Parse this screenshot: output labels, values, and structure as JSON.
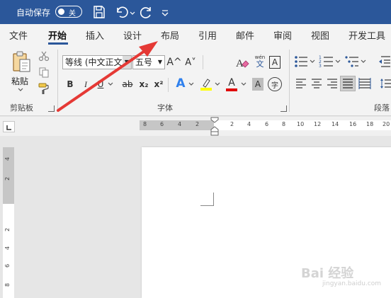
{
  "titlebar": {
    "autosave_label": "自动保存",
    "autosave_state": "关",
    "bg_color": "#2b579a"
  },
  "qat": {
    "save": "save-icon",
    "undo": "undo-icon",
    "redo": "redo-icon",
    "customize": "customize-icon"
  },
  "tabs": [
    {
      "label": "文件"
    },
    {
      "label": "开始",
      "active": true
    },
    {
      "label": "插入"
    },
    {
      "label": "设计"
    },
    {
      "label": "布局"
    },
    {
      "label": "引用"
    },
    {
      "label": "邮件"
    },
    {
      "label": "审阅"
    },
    {
      "label": "视图"
    },
    {
      "label": "开发工具"
    }
  ],
  "clipboard": {
    "paste_label": "粘贴",
    "group_label": "剪贴板"
  },
  "font": {
    "name": "等线 (中文正文",
    "size": "五号",
    "group_label": "字体",
    "bold": "B",
    "italic": "I",
    "underline": "U",
    "strikethrough": "ab",
    "subscript": "x₂",
    "superscript": "x²",
    "grow": "A^",
    "shrink": "A˅",
    "clear": "A",
    "phonetic": "wén",
    "phonetic_char": "文",
    "border_char": "A",
    "effect": "A",
    "highlight_color": "#ffff00",
    "font_color_char": "A",
    "font_color": "#e00000",
    "shading_char": "A",
    "enclose_char": "字"
  },
  "paragraph": {
    "group_label": "段落"
  },
  "ruler": {
    "h_left": [
      "8",
      "6",
      "4",
      "2"
    ],
    "h_right": [
      "2",
      "4",
      "6",
      "8",
      "10",
      "12",
      "14",
      "16",
      "18",
      "20"
    ],
    "v_top": [
      "4",
      "2"
    ],
    "v_bottom": [
      "2",
      "4",
      "6",
      "8"
    ]
  },
  "watermark": {
    "text": "Bai 经验",
    "sub": "jingyan.baidu.com"
  },
  "annotation_color": "#e53935"
}
